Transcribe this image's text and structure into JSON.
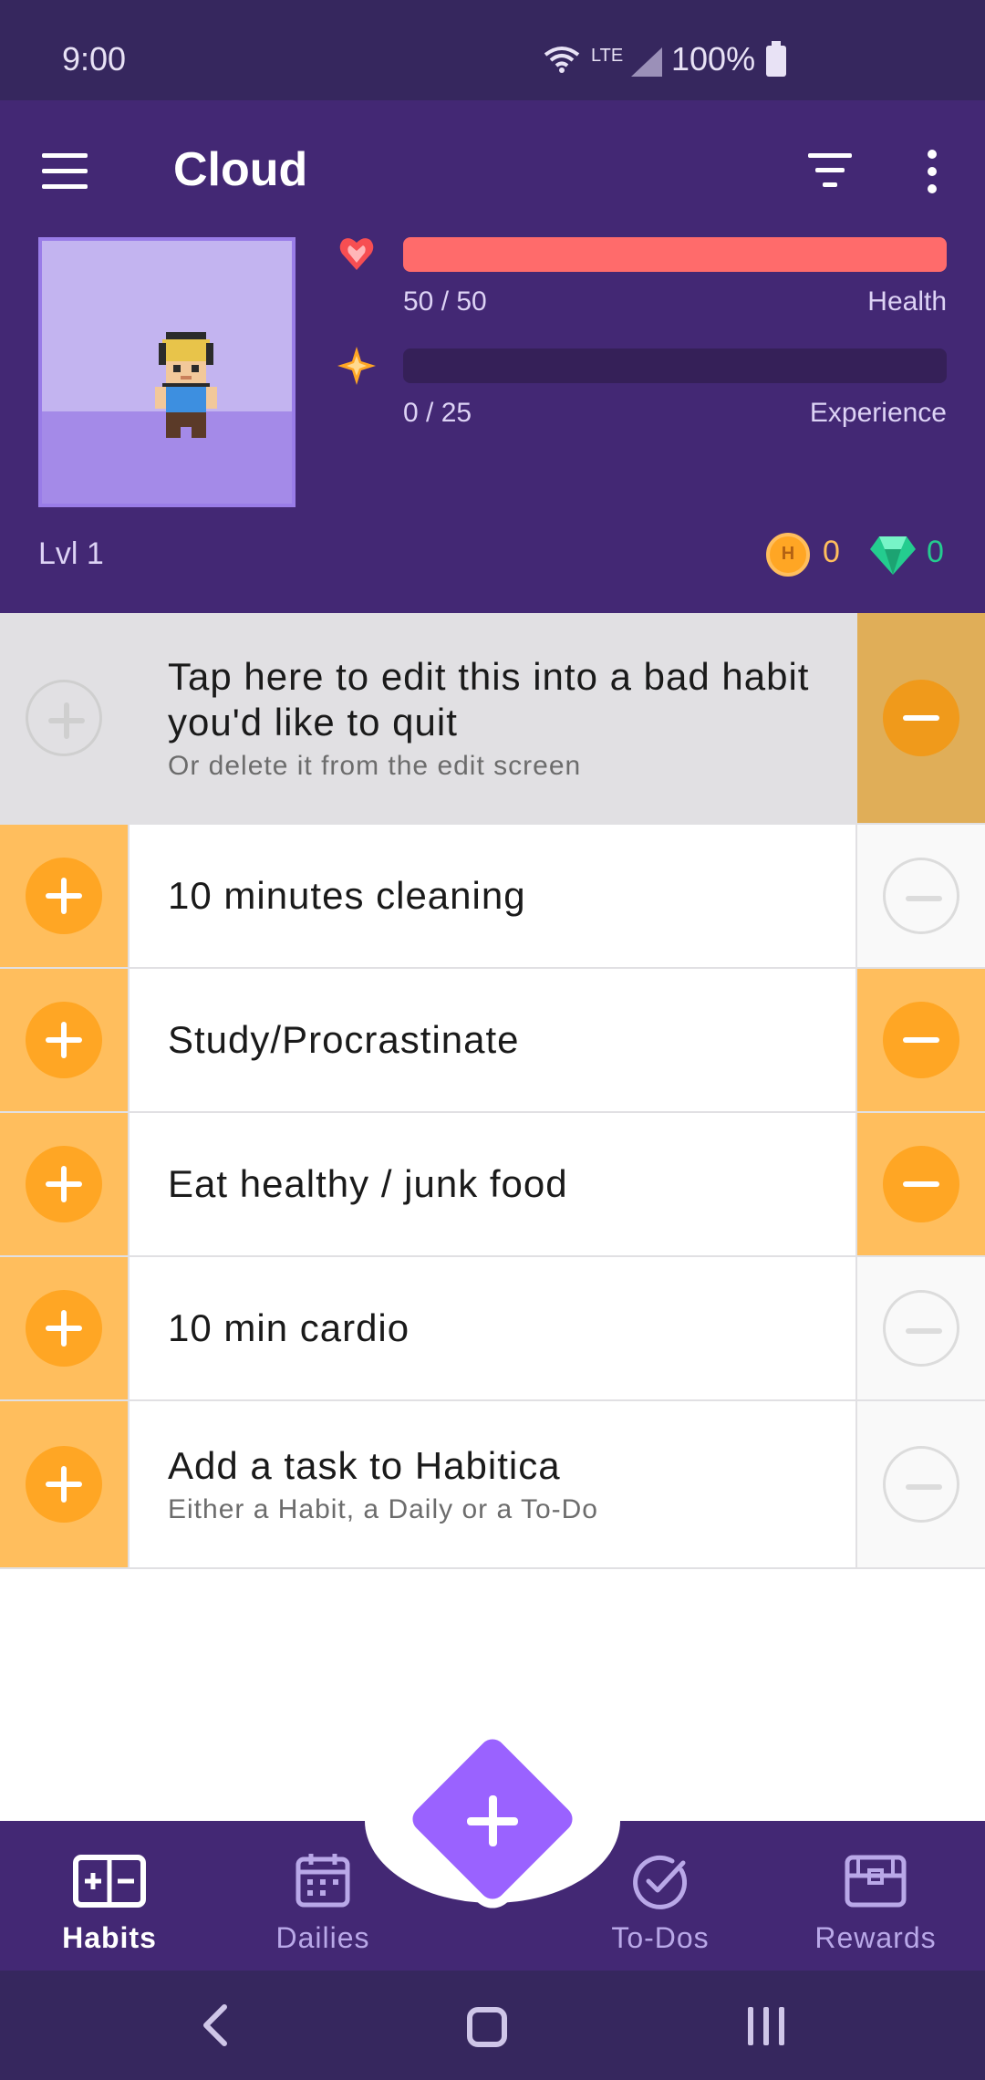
{
  "status_bar": {
    "time": "9:00",
    "network": "LTE",
    "battery": "100%"
  },
  "header": {
    "title": "Cloud",
    "health": {
      "value": "50 / 50",
      "label": "Health",
      "fraction": 1.0
    },
    "experience": {
      "value": "0 / 25",
      "label": "Experience",
      "fraction": 0.0
    },
    "level": "Lvl 1",
    "gold": "0",
    "gems": "0"
  },
  "habits": [
    {
      "title": "Tap here to edit this into a bad habit you'd like to quit",
      "notes": "Or delete it from the edit screen"
    },
    {
      "title": "10 minutes cleaning",
      "notes": ""
    },
    {
      "title": "Study/Procrastinate",
      "notes": ""
    },
    {
      "title": "Eat healthy / junk food",
      "notes": ""
    },
    {
      "title": "10 min cardio",
      "notes": ""
    },
    {
      "title": "Add a task to Habitica",
      "notes": "Either a Habit, a Daily or a To-Do"
    }
  ],
  "bottom_nav": {
    "habits": "Habits",
    "dailies": "Dailies",
    "todos": "To-Dos",
    "rewards": "Rewards"
  },
  "colors": {
    "header_purple": "#432874",
    "status_purple": "#36275e",
    "habit_orange": "#ffa624",
    "habit_orange_light": "#ffbe5d",
    "health_red": "#ff6b6b",
    "fab_purple": "#9a62ff",
    "gem_green": "#24cc8f"
  },
  "icons": {
    "menu": "hamburger-icon",
    "filter": "filter-icon",
    "more": "more-vertical-icon",
    "health": "heart-icon",
    "experience": "star-icon",
    "gold": "gold-coin-icon",
    "gems": "gem-icon"
  }
}
